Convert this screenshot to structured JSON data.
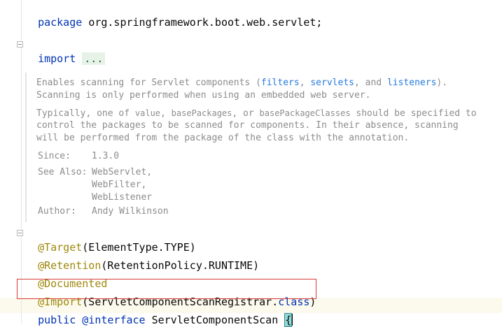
{
  "code": {
    "package_kw": "package",
    "package_name": "org.springframework.boot.web.servlet;",
    "import_kw": "import",
    "import_folded": "...",
    "ann_target": "@Target",
    "target_args": "(ElementType.TYPE)",
    "ann_retention": "@Retention",
    "retention_args": "(RetentionPolicy.RUNTIME)",
    "ann_documented": "@Documented",
    "ann_import": "@Import",
    "import_args_open": "(ServletComponentScanRegistrar.",
    "import_class_kw": "class",
    "import_args_close": ")",
    "public_kw": "public",
    "interface_kw": "@interface",
    "type_name": "ServletComponentScan",
    "open_brace": "{"
  },
  "javadoc": {
    "para1_a": "Enables scanning for Servlet components (",
    "link_filters": "filters",
    "sep1": ", ",
    "link_servlets": "servlets",
    "sep2": ", and ",
    "link_listeners": "listeners",
    "para1_b": ").",
    "para1_line2": "Scanning is only performed when using an embedded web server.",
    "para2_a": "Typically, one of ",
    "code_value": "value",
    "para2_sep1": ", ",
    "code_basepackages": "basePackages",
    "para2_sep2": ", or ",
    "code_basepackageclasses": "basePackageClasses",
    "para2_b": " should be specified to",
    "para2_line2": "control the packages to be scanned for components. In their absence, scanning",
    "para2_line3": "will be performed from the package of the class with the annotation.",
    "since_label": "Since:",
    "since_value": "1.3.0",
    "seealso_label": "See Also:",
    "seealso_items": [
      "WebServlet,",
      "WebFilter,",
      "WebListener"
    ],
    "author_label": "Author:",
    "author_value": "Andy Wilkinson"
  },
  "colors": {
    "keyword": "#0033b3",
    "annotation": "#9e880d",
    "doc_link": "#287bde",
    "doc_text": "#8c8c8c",
    "highlight_box": "#d83b3b"
  }
}
